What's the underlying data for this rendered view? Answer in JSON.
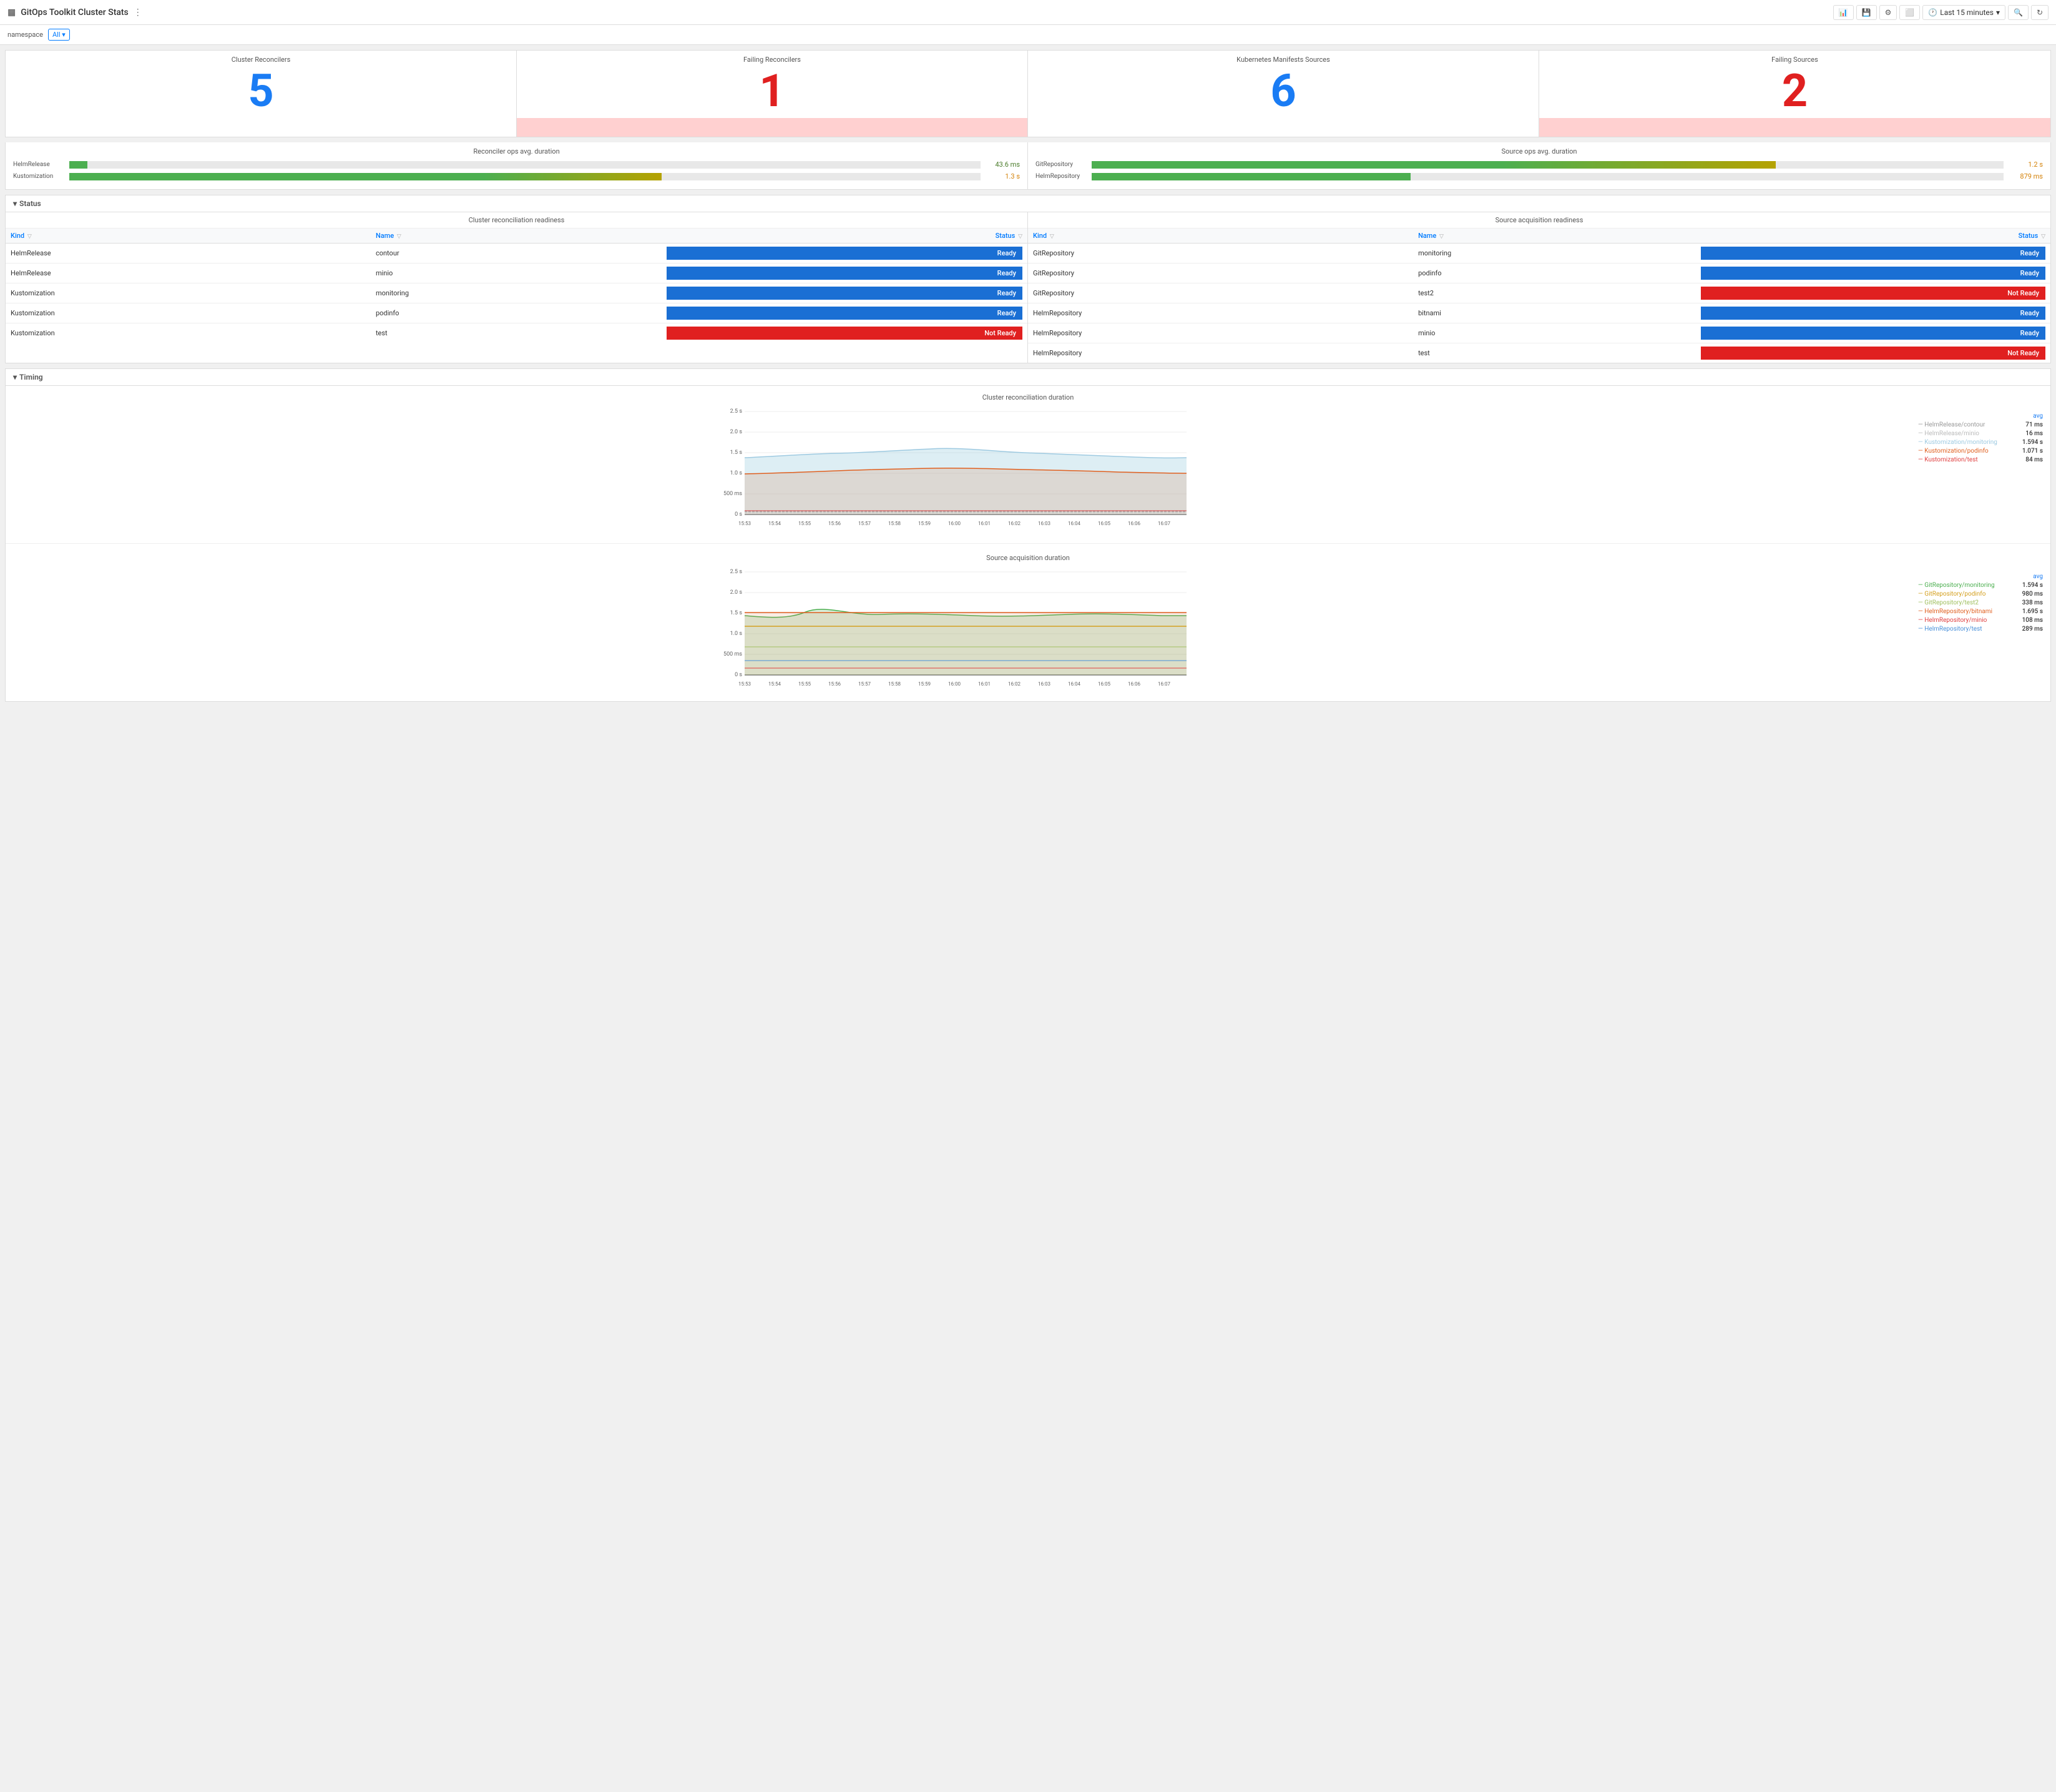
{
  "topBar": {
    "appIcon": "▦",
    "title": "GitOps Toolkit Cluster Stats",
    "shareIcon": "⋮",
    "timeSelector": "Last 15 minutes",
    "buttons": [
      "📊",
      "💾",
      "⚙",
      "⬜"
    ]
  },
  "filterBar": {
    "label": "namespace",
    "value": "All"
  },
  "statCards": [
    {
      "title": "Cluster Reconcilers",
      "value": "5",
      "color": "blue",
      "hasPinkBg": false
    },
    {
      "title": "Failing Reconcilers",
      "value": "1",
      "color": "red",
      "hasPinkBg": true
    },
    {
      "title": "Kubernetes Manifests Sources",
      "value": "6",
      "color": "blue",
      "hasPinkBg": false
    },
    {
      "title": "Failing Sources",
      "value": "2",
      "color": "red",
      "hasPinkBg": true
    }
  ],
  "avgPanels": [
    {
      "title": "Reconciler ops avg. duration",
      "bars": [
        {
          "label": "HelmRelease",
          "barClass": "green-short",
          "value": "43.6 ms",
          "valueClass": "green"
        },
        {
          "label": "Kustomization",
          "barClass": "green-long",
          "value": "1.3 s",
          "valueClass": "orange"
        }
      ]
    },
    {
      "title": "Source ops avg. duration",
      "bars": [
        {
          "label": "GitRepository",
          "barClass": "git-long",
          "value": "1.2 s",
          "valueClass": "orange"
        },
        {
          "label": "HelmRepository",
          "barClass": "helm-medium",
          "value": "879 ms",
          "valueClass": "orange"
        }
      ]
    }
  ],
  "statusSection": {
    "header": "Status",
    "reconciliation": {
      "title": "Cluster reconciliation readiness",
      "columns": [
        "Kind",
        "Name",
        "Status"
      ],
      "rows": [
        {
          "kind": "HelmRelease",
          "name": "contour",
          "status": "Ready",
          "statusClass": "status-ready"
        },
        {
          "kind": "HelmRelease",
          "name": "minio",
          "status": "Ready",
          "statusClass": "status-ready"
        },
        {
          "kind": "Kustomization",
          "name": "monitoring",
          "status": "Ready",
          "statusClass": "status-ready"
        },
        {
          "kind": "Kustomization",
          "name": "podinfo",
          "status": "Ready",
          "statusClass": "status-ready"
        },
        {
          "kind": "Kustomization",
          "name": "test",
          "status": "Not Ready",
          "statusClass": "status-not-ready"
        }
      ]
    },
    "acquisition": {
      "title": "Source acquisition readiness",
      "columns": [
        "Kind",
        "Name",
        "Status"
      ],
      "rows": [
        {
          "kind": "GitRepository",
          "name": "monitoring",
          "status": "Ready",
          "statusClass": "status-ready"
        },
        {
          "kind": "GitRepository",
          "name": "podinfo",
          "status": "Ready",
          "statusClass": "status-ready"
        },
        {
          "kind": "GitRepository",
          "name": "test2",
          "status": "Not Ready",
          "statusClass": "status-not-ready"
        },
        {
          "kind": "HelmRepository",
          "name": "bitnami",
          "status": "Ready",
          "statusClass": "status-ready"
        },
        {
          "kind": "HelmRepository",
          "name": "minio",
          "status": "Ready",
          "statusClass": "status-ready"
        },
        {
          "kind": "HelmRepository",
          "name": "test",
          "status": "Not Ready",
          "statusClass": "status-not-ready"
        }
      ]
    }
  },
  "timingSection": {
    "header": "Timing",
    "chart1": {
      "title": "Cluster reconciliation duration",
      "yLabels": [
        "2.5 s",
        "2.0 s",
        "1.5 s",
        "1.0 s",
        "500 ms",
        "0 s"
      ],
      "xLabels": [
        "15:53",
        "15:54",
        "15:55",
        "15:56",
        "15:57",
        "15:58",
        "15:59",
        "16:00",
        "16:01",
        "16:02",
        "16:03",
        "16:04",
        "16:05",
        "16:06",
        "16:07"
      ],
      "legend": [
        {
          "label": "HelmRelease/contour",
          "value": "71 ms",
          "color": "#666"
        },
        {
          "label": "HelmRelease/minio",
          "value": "16 ms",
          "color": "#666"
        },
        {
          "label": "Kustomization/monitoring",
          "value": "1.594 s",
          "color": "#9ecae1"
        },
        {
          "label": "Kustomization/podinfo",
          "value": "1.071 s",
          "color": "#e06020"
        },
        {
          "label": "Kustomization/test",
          "value": "84 ms",
          "color": "#e04040"
        }
      ]
    },
    "chart2": {
      "title": "Source acquisition duration",
      "yLabels": [
        "2.5 s",
        "2.0 s",
        "1.5 s",
        "1.0 s",
        "500 ms",
        "0 s"
      ],
      "xLabels": [
        "15:53",
        "15:54",
        "15:55",
        "15:56",
        "15:57",
        "15:58",
        "15:59",
        "16:00",
        "16:01",
        "16:02",
        "16:03",
        "16:04",
        "16:05",
        "16:06",
        "16:07"
      ],
      "legend": [
        {
          "label": "GitRepository/monitoring",
          "value": "1.594 s",
          "color": "#4caf50"
        },
        {
          "label": "GitRepository/podinfo",
          "value": "980 ms",
          "color": "#d4a020"
        },
        {
          "label": "GitRepository/test2",
          "value": "338 ms",
          "color": "#a0c060"
        },
        {
          "label": "HelmRepository/bitnami",
          "value": "1.695 s",
          "color": "#e06020"
        },
        {
          "label": "HelmRepository/minio",
          "value": "108 ms",
          "color": "#e04040"
        },
        {
          "label": "HelmRepository/test",
          "value": "289 ms",
          "color": "#4a90d9"
        }
      ]
    }
  }
}
